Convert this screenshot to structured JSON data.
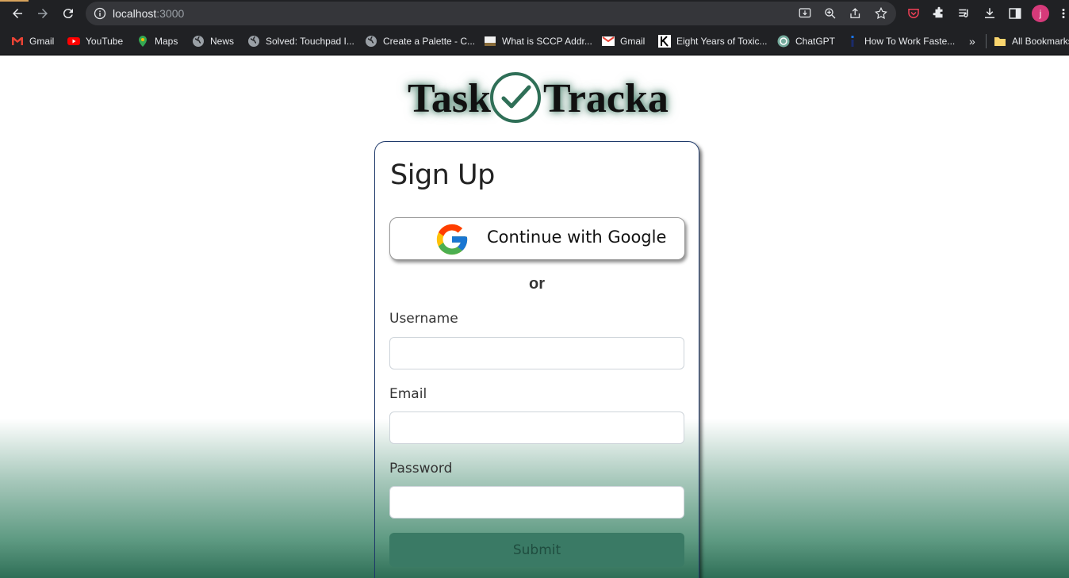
{
  "browser": {
    "url_host": "localhost",
    "url_port": ":3000",
    "profile_initial": "j",
    "bookmarks": [
      {
        "label": "Gmail",
        "icon": "gmail-icon"
      },
      {
        "label": "YouTube",
        "icon": "youtube-icon"
      },
      {
        "label": "Maps",
        "icon": "maps-icon"
      },
      {
        "label": "News",
        "icon": "globe-icon"
      },
      {
        "label": "Solved: Touchpad I...",
        "icon": "globe-icon"
      },
      {
        "label": "Create a Palette - C...",
        "icon": "globe-icon"
      },
      {
        "label": "What is SCCP Addr...",
        "icon": "page-icon"
      },
      {
        "label": "Gmail",
        "icon": "gmail-icon"
      },
      {
        "label": "Eight Years of Toxic...",
        "icon": "k-icon"
      },
      {
        "label": "ChatGPT",
        "icon": "chatgpt-icon"
      },
      {
        "label": "How To Work Faste...",
        "icon": "info-icon"
      }
    ],
    "overflow": "»",
    "all_bookmarks": "All Bookmarks"
  },
  "logo": {
    "left": "Task",
    "right": "Tracka"
  },
  "form": {
    "title": "Sign Up",
    "google_label": "Continue with Google",
    "separator": "or",
    "username_label": "Username",
    "email_label": "Email",
    "password_label": "Password",
    "submit_label": "Submit",
    "username_value": "",
    "email_value": "",
    "password_value": ""
  },
  "colors": {
    "brand_green": "#2f6f57",
    "submit_bg": "#3a7a65",
    "card_border": "#1f3a6b"
  }
}
